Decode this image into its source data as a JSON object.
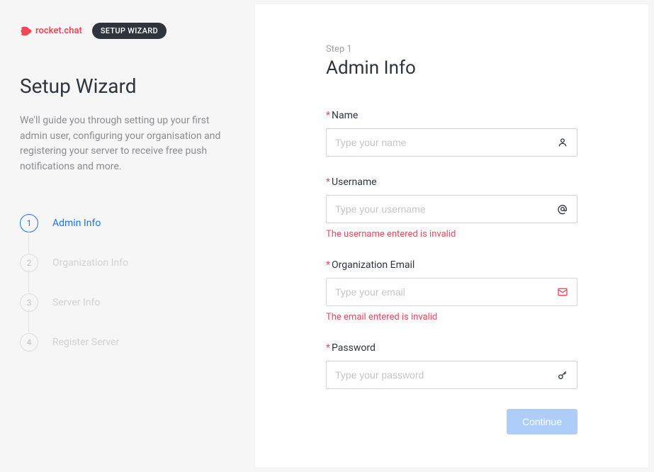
{
  "header": {
    "logo_text": "rocket.chat",
    "badge": "SETUP WIZARD"
  },
  "sidebar": {
    "title": "Setup Wizard",
    "description": "We'll guide you through setting up your first admin user, configuring your organisation and registering your server to receive free push notifications and more.",
    "steps": [
      {
        "num": "1",
        "label": "Admin Info"
      },
      {
        "num": "2",
        "label": "Organization Info"
      },
      {
        "num": "3",
        "label": "Server Info"
      },
      {
        "num": "4",
        "label": "Register Server"
      }
    ]
  },
  "form": {
    "step_indicator": "Step 1",
    "title": "Admin Info",
    "name": {
      "label": "Name",
      "placeholder": "Type your name",
      "value": ""
    },
    "username": {
      "label": "Username",
      "placeholder": "Type your username",
      "value": "",
      "error": "The username entered is invalid"
    },
    "email": {
      "label": "Organization Email",
      "placeholder": "Type your email",
      "value": "",
      "error": "The email entered is invalid"
    },
    "password": {
      "label": "Password",
      "placeholder": "Type your password",
      "value": ""
    },
    "continue_label": "Continue"
  }
}
